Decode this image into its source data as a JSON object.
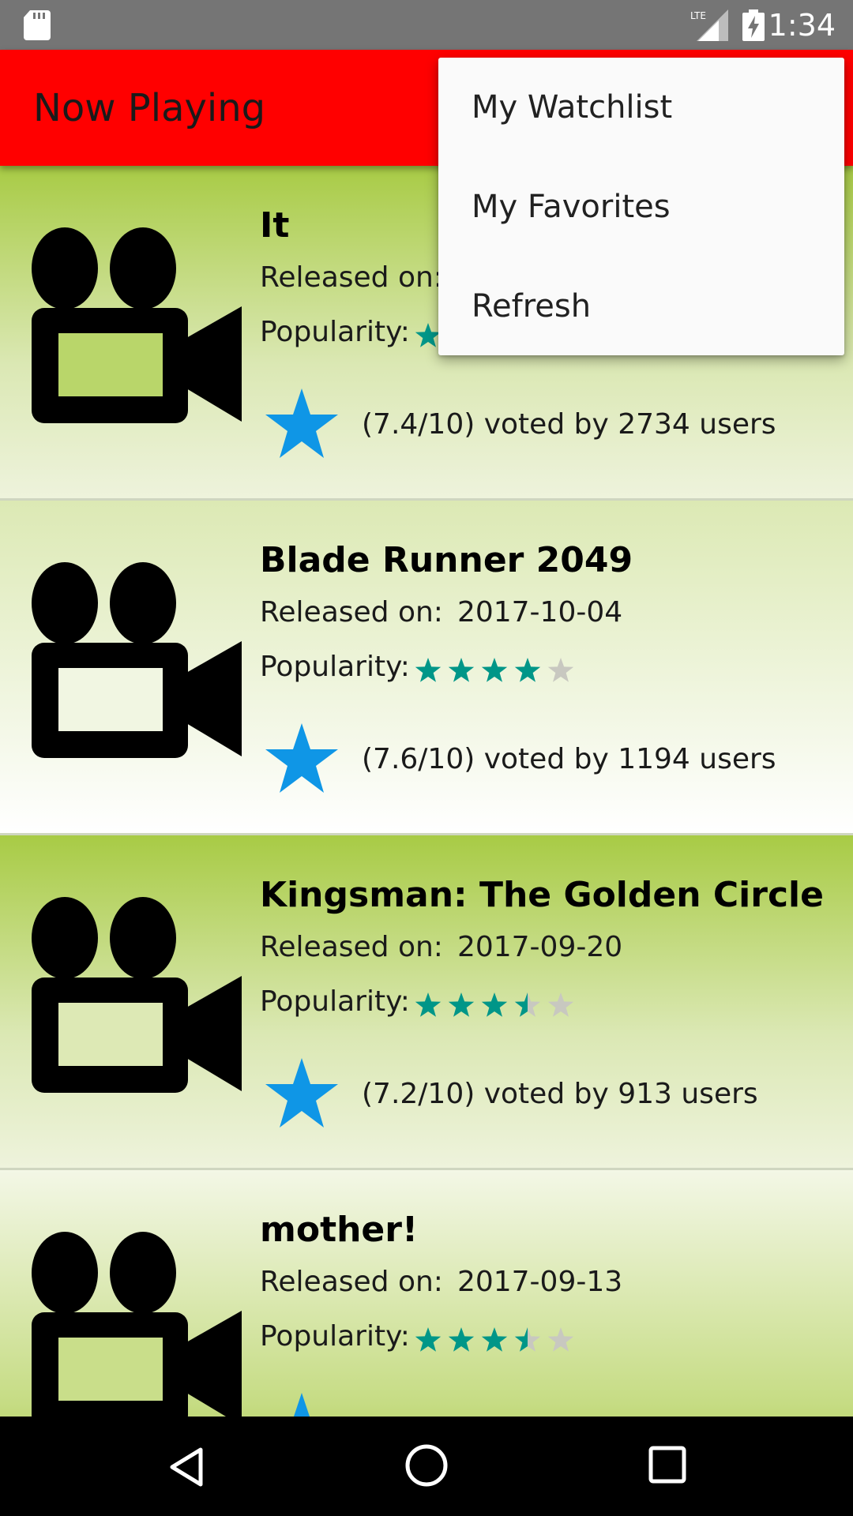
{
  "status_bar": {
    "time": "1:34",
    "network_label": "LTE",
    "icons": [
      "sd-card-icon",
      "signal-icon",
      "battery-charging-icon"
    ]
  },
  "app_bar": {
    "title": "Now Playing"
  },
  "overflow_menu": {
    "items": [
      {
        "label": "My Watchlist"
      },
      {
        "label": "My Favorites"
      },
      {
        "label": "Refresh"
      }
    ]
  },
  "movies": [
    {
      "title": "It",
      "released_label": "Released on:",
      "release_date": "",
      "popularity_label": "Popularity:",
      "popularity_stars": 4.0,
      "vote_text": "(7.4/10) voted by 2734 users"
    },
    {
      "title": "Blade Runner 2049",
      "released_label": "Released on:",
      "release_date": "2017-10-04",
      "popularity_label": "Popularity:",
      "popularity_stars": 4.0,
      "vote_text": "(7.6/10) voted by 1194 users"
    },
    {
      "title": "Kingsman: The Golden Circle",
      "released_label": "Released on:",
      "release_date": "2017-09-20",
      "popularity_label": "Popularity:",
      "popularity_stars": 3.5,
      "vote_text": "(7.2/10) voted by 913 users"
    },
    {
      "title": "mother!",
      "released_label": "Released on:",
      "release_date": "2017-09-13",
      "popularity_label": "Popularity:",
      "popularity_stars": 3.5,
      "vote_text": ""
    }
  ],
  "colors": {
    "app_bar": "#ff0000",
    "star_filled": "#009688",
    "star_empty": "#c8c8c0",
    "vote_star": "#0f96e6"
  },
  "nav_bar": {
    "icons": [
      "back-icon",
      "home-icon",
      "recents-icon"
    ]
  }
}
